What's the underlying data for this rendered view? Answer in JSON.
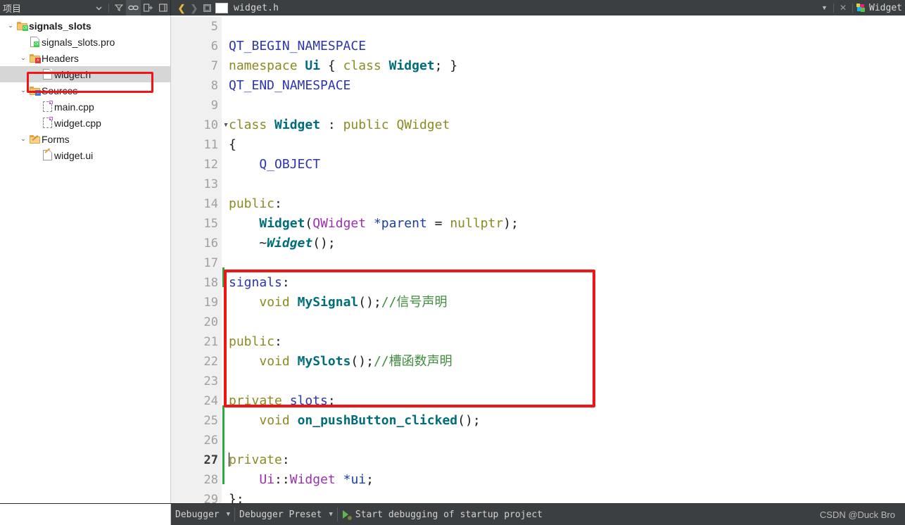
{
  "topbar": {
    "panel_title": "项目",
    "left_icons": [
      {
        "name": "filter-icon",
        "glyph": "filter"
      },
      {
        "name": "link-sync-icon",
        "glyph": "link",
        "active": true
      },
      {
        "name": "split-pane-icon",
        "glyph": "split"
      },
      {
        "name": "close-pane-icon",
        "glyph": "close-pane"
      }
    ],
    "nav_back": "❮",
    "nav_forward": "❯",
    "open_file_tab": "widget.h",
    "right_close": "✕",
    "right_label": "Widget"
  },
  "sidebar": {
    "tree": [
      {
        "label": "signals_slots",
        "depth": 0,
        "twisty": "⌄",
        "icon": "folder-qt-icon",
        "bold": true,
        "selected": false
      },
      {
        "label": "signals_slots.pro",
        "depth": 1,
        "twisty": "",
        "icon": "file-qt-icon",
        "bold": false,
        "selected": false
      },
      {
        "label": "Headers",
        "depth": 1,
        "twisty": "⌄",
        "icon": "folder-h-icon",
        "bold": false,
        "selected": false
      },
      {
        "label": "widget.h",
        "depth": 2,
        "twisty": "",
        "icon": "file-plain-icon",
        "bold": false,
        "selected": true
      },
      {
        "label": "Sources",
        "depth": 1,
        "twisty": "⌄",
        "icon": "folder-cpp-icon",
        "bold": false,
        "selected": false
      },
      {
        "label": "main.cpp",
        "depth": 2,
        "twisty": "",
        "icon": "file-cpp-icon",
        "bold": false,
        "selected": false
      },
      {
        "label": "widget.cpp",
        "depth": 2,
        "twisty": "",
        "icon": "file-cpp-icon",
        "bold": false,
        "selected": false
      },
      {
        "label": "Forms",
        "depth": 1,
        "twisty": "⌄",
        "icon": "folder-ui-icon",
        "bold": false,
        "selected": false
      },
      {
        "label": "widget.ui",
        "depth": 2,
        "twisty": "",
        "icon": "file-ui-icon",
        "bold": false,
        "selected": false
      }
    ]
  },
  "editor": {
    "first_line_number": 5,
    "current_line": 27,
    "fold_lines": [
      10
    ],
    "lines": [
      {
        "n": 5,
        "tokens": []
      },
      {
        "n": 6,
        "tokens": [
          {
            "t": "QT_BEGIN_NAMESPACE",
            "c": "t-pre"
          }
        ]
      },
      {
        "n": 7,
        "tokens": [
          {
            "t": "namespace ",
            "c": "t-kw"
          },
          {
            "t": "Ui",
            "c": "t-type"
          },
          {
            "t": " { ",
            "c": "t-plain"
          },
          {
            "t": "class ",
            "c": "t-kw"
          },
          {
            "t": "Widget",
            "c": "t-type"
          },
          {
            "t": "; }",
            "c": "t-plain"
          }
        ]
      },
      {
        "n": 8,
        "tokens": [
          {
            "t": "QT_END_NAMESPACE",
            "c": "t-pre"
          }
        ]
      },
      {
        "n": 9,
        "tokens": []
      },
      {
        "n": 10,
        "tokens": [
          {
            "t": "class ",
            "c": "t-kw"
          },
          {
            "t": "Widget",
            "c": "t-type"
          },
          {
            "t": " : ",
            "c": "t-plain"
          },
          {
            "t": "public ",
            "c": "t-kw"
          },
          {
            "t": "QWidget",
            "c": "t-num"
          }
        ]
      },
      {
        "n": 11,
        "tokens": [
          {
            "t": "{",
            "c": "t-plain"
          }
        ]
      },
      {
        "n": 12,
        "tokens": [
          {
            "t": "    Q_OBJECT",
            "c": "t-pre"
          }
        ]
      },
      {
        "n": 13,
        "tokens": []
      },
      {
        "n": 14,
        "tokens": [
          {
            "t": "public",
            "c": "t-kw"
          },
          {
            "t": ":",
            "c": "t-plain"
          }
        ]
      },
      {
        "n": 15,
        "tokens": [
          {
            "t": "    ",
            "c": "t-plain"
          },
          {
            "t": "Widget",
            "c": "t-type"
          },
          {
            "t": "(",
            "c": "t-plain"
          },
          {
            "t": "QWidget",
            "c": "t-cls"
          },
          {
            "t": " ",
            "c": "t-plain"
          },
          {
            "t": "*parent",
            "c": "t-var"
          },
          {
            "t": " = ",
            "c": "t-plain"
          },
          {
            "t": "nullptr",
            "c": "t-num"
          },
          {
            "t": ");",
            "c": "t-plain"
          }
        ]
      },
      {
        "n": 16,
        "tokens": [
          {
            "t": "    ~",
            "c": "t-plain"
          },
          {
            "t": "Widget",
            "c": "t-typei"
          },
          {
            "t": "();",
            "c": "t-plain"
          }
        ]
      },
      {
        "n": 17,
        "tokens": []
      },
      {
        "n": 18,
        "tokens": [
          {
            "t": "signals",
            "c": "t-sig"
          },
          {
            "t": ":",
            "c": "t-plain"
          }
        ]
      },
      {
        "n": 19,
        "tokens": [
          {
            "t": "    ",
            "c": "t-plain"
          },
          {
            "t": "void",
            "c": "t-kw"
          },
          {
            "t": " ",
            "c": "t-plain"
          },
          {
            "t": "MySignal",
            "c": "t-fn"
          },
          {
            "t": "();",
            "c": "t-plain"
          },
          {
            "t": "//信号声明",
            "c": "t-cmt"
          }
        ]
      },
      {
        "n": 20,
        "tokens": []
      },
      {
        "n": 21,
        "tokens": [
          {
            "t": "public",
            "c": "t-kw"
          },
          {
            "t": ":",
            "c": "t-plain"
          }
        ]
      },
      {
        "n": 22,
        "tokens": [
          {
            "t": "    ",
            "c": "t-plain"
          },
          {
            "t": "void",
            "c": "t-kw"
          },
          {
            "t": " ",
            "c": "t-plain"
          },
          {
            "t": "MySlots",
            "c": "t-fn"
          },
          {
            "t": "();",
            "c": "t-plain"
          },
          {
            "t": "//槽函数声明",
            "c": "t-cmt"
          }
        ]
      },
      {
        "n": 23,
        "tokens": []
      },
      {
        "n": 24,
        "tokens": [
          {
            "t": "private ",
            "c": "t-kw"
          },
          {
            "t": "slots",
            "c": "t-sig"
          },
          {
            "t": ":",
            "c": "t-plain"
          }
        ]
      },
      {
        "n": 25,
        "tokens": [
          {
            "t": "    ",
            "c": "t-plain"
          },
          {
            "t": "void",
            "c": "t-kw"
          },
          {
            "t": " ",
            "c": "t-plain"
          },
          {
            "t": "on_pushButton_clicked",
            "c": "t-fn"
          },
          {
            "t": "();",
            "c": "t-plain"
          }
        ]
      },
      {
        "n": 26,
        "tokens": []
      },
      {
        "n": 27,
        "tokens": [
          {
            "t": "private",
            "c": "t-kw"
          },
          {
            "t": ":",
            "c": "t-plain"
          }
        ],
        "caret": true
      },
      {
        "n": 28,
        "tokens": [
          {
            "t": "    ",
            "c": "t-plain"
          },
          {
            "t": "Ui",
            "c": "t-cls"
          },
          {
            "t": "::",
            "c": "t-plain"
          },
          {
            "t": "Widget",
            "c": "t-cls"
          },
          {
            "t": " ",
            "c": "t-plain"
          },
          {
            "t": "*ui",
            "c": "t-var"
          },
          {
            "t": ";",
            "c": "t-plain"
          }
        ]
      },
      {
        "n": 29,
        "tokens": [
          {
            "t": "};",
            "c": "t-plain"
          }
        ]
      }
    ]
  },
  "statusbar": {
    "run_config": "Debugger",
    "preset": "Debugger Preset",
    "action_text": "Start debugging of startup project",
    "watermark": "CSDN @Duck Bro"
  },
  "annotations": {
    "sidebar_box_color": "#f01414",
    "code_box_color": "#f01414"
  }
}
